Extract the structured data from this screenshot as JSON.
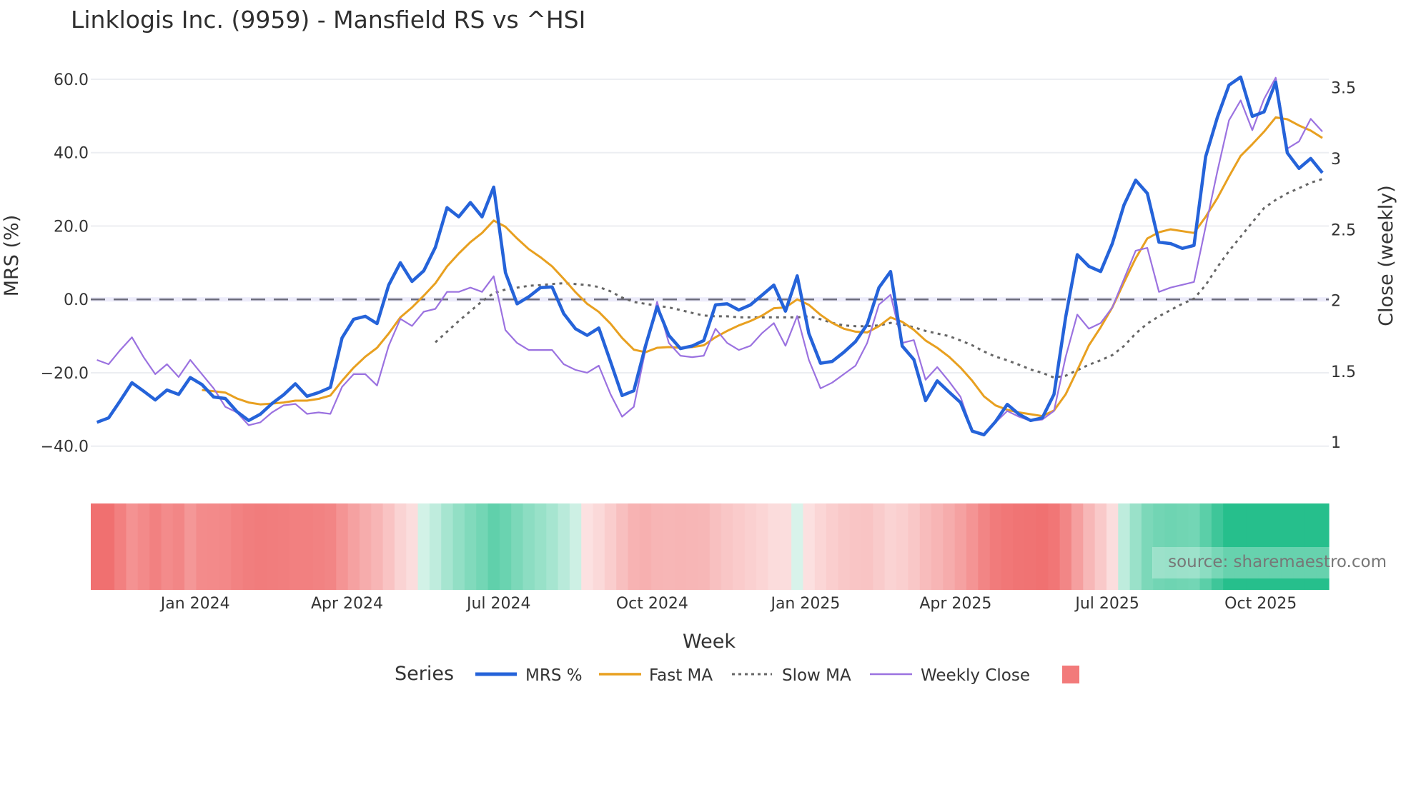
{
  "chart_data": {
    "type": "line",
    "title": "Linklogis Inc. (9959) - Mansfield RS vs ^HSI",
    "xlabel": "Week",
    "ylabel": "MRS (%)",
    "y2label": "Close (weekly)",
    "start_week": "2023-11-03",
    "x_ticks": [
      {
        "label": "Jan 2024",
        "date": "2024-01-01"
      },
      {
        "label": "Apr 2024",
        "date": "2024-04-01"
      },
      {
        "label": "Jul 2024",
        "date": "2024-07-01"
      },
      {
        "label": "Oct 2024",
        "date": "2024-10-01"
      },
      {
        "label": "Jan 2025",
        "date": "2025-01-01"
      },
      {
        "label": "Apr 2025",
        "date": "2025-04-01"
      },
      {
        "label": "Jul 2025",
        "date": "2025-07-01"
      },
      {
        "label": "Oct 2025",
        "date": "2025-10-01"
      }
    ],
    "y_ticks": [
      "60.0",
      "40.0",
      "20.0",
      "0.0",
      "−20.0",
      "−40.0"
    ],
    "y_tick_values": [
      60,
      40,
      20,
      0,
      -20,
      -40
    ],
    "y2_ticks": [
      "3.5",
      "3",
      "2.5",
      "2",
      "1.5",
      "1"
    ],
    "y2_tick_values": [
      3.5,
      3,
      2.5,
      2,
      1.5,
      1
    ],
    "ylim": [
      -45.5,
      67
    ],
    "y2lim": [
      0.83,
      3.74
    ],
    "grid": true,
    "zero_line": 0,
    "series": [
      {
        "name": "MRS %",
        "color": "#2563d9",
        "axis": "left",
        "values": [
          -33.5,
          -32.3,
          -27.6,
          -22.7,
          -25,
          -27.4,
          -24.7,
          -25.9,
          -21.3,
          -23.2,
          -26.6,
          -27,
          -30.6,
          -33,
          -31.3,
          -28.4,
          -26,
          -23,
          -26.4,
          -25.4,
          -24,
          -10.5,
          -5.4,
          -4.6,
          -6.6,
          3.9,
          10,
          4.9,
          7.8,
          14.2,
          25,
          22.5,
          26.4,
          22.5,
          30.6,
          7.3,
          -1.2,
          0.7,
          3.2,
          3.4,
          -3.9,
          -8,
          -9.8,
          -7.8,
          -16.9,
          -26.2,
          -24.9,
          -12.7,
          -2,
          -9.8,
          -13.4,
          -12.7,
          -11.2,
          -1.5,
          -1.2,
          -2.9,
          -1.5,
          1.2,
          3.9,
          -3.2,
          6.4,
          -9.3,
          -17.4,
          -16.9,
          -14.4,
          -11.5,
          -6.8,
          3.2,
          7.6,
          -12.7,
          -16.4,
          -27.6,
          -22.2,
          -25.2,
          -28.1,
          -35.9,
          -36.9,
          -33.3,
          -28.6,
          -31.3,
          -33,
          -32.3,
          -25.9,
          -4.9,
          12.2,
          9,
          7.6,
          15.2,
          25.7,
          32.5,
          28.9,
          15.6,
          15.2,
          13.9,
          14.7,
          38.9,
          49.6,
          58.4,
          60.6,
          49.9,
          51.1,
          59.2,
          39.9,
          35.7,
          38.4,
          34.5
        ]
      },
      {
        "name": "Fast MA",
        "color": "#e8a020",
        "axis": "left",
        "values": [
          -24.7,
          -25,
          -25.4,
          -27,
          -28.1,
          -28.6,
          -28.4,
          -28.1,
          -27.6,
          -27.6,
          -27.1,
          -26.2,
          -22.2,
          -18.6,
          -15.6,
          -13.2,
          -9.3,
          -4.9,
          -2.2,
          1,
          4.4,
          9,
          12.5,
          15.6,
          18.1,
          21.5,
          19.8,
          16.6,
          13.7,
          11.5,
          9,
          5.6,
          2,
          -1.2,
          -3.4,
          -6.6,
          -10.5,
          -13.7,
          -14.4,
          -13.2,
          -13,
          -13.2,
          -13,
          -12.5,
          -10.3,
          -8.6,
          -7.1,
          -5.9,
          -4.4,
          -2.4,
          -2.2,
          0,
          -1.5,
          -4.2,
          -6.4,
          -8,
          -8.8,
          -9,
          -7.3,
          -4.9,
          -6.1,
          -8.3,
          -11.2,
          -13.2,
          -15.6,
          -18.6,
          -22.2,
          -26.4,
          -28.9,
          -30.1,
          -30.8,
          -31.3,
          -31.8,
          -30.3,
          -25.9,
          -19.3,
          -12.5,
          -7.6,
          -2.2,
          4.6,
          11.2,
          16.6,
          18.3,
          19.1,
          18.6,
          18.1,
          22.5,
          27.6,
          33.5,
          39.1,
          42.3,
          45.7,
          49.6,
          49.1,
          47.4,
          46,
          44
        ]
      },
      {
        "name": "Slow MA",
        "color": "#666666",
        "axis": "left",
        "dash": "dot",
        "values": [
          -11.7,
          -8.8,
          -5.9,
          -3.2,
          -0.5,
          1.7,
          2.7,
          3.2,
          3.7,
          3.9,
          4.2,
          4.4,
          4.2,
          3.9,
          3.4,
          2.2,
          0.5,
          -0.7,
          -1.2,
          -1.7,
          -2.2,
          -2.9,
          -3.7,
          -4.4,
          -4.6,
          -4.6,
          -4.9,
          -4.9,
          -4.9,
          -4.9,
          -4.9,
          -4.9,
          -4.6,
          -5.4,
          -6.4,
          -7.1,
          -7.3,
          -7.3,
          -7.1,
          -6.4,
          -6.8,
          -7.6,
          -8.6,
          -9.3,
          -10,
          -11.2,
          -12.5,
          -14.2,
          -15.6,
          -16.6,
          -17.8,
          -19.1,
          -20,
          -21.3,
          -20.8,
          -19.3,
          -17.8,
          -16.6,
          -15.2,
          -12.7,
          -9.3,
          -6.6,
          -4.6,
          -2.9,
          -1.2,
          0.2,
          3.9,
          8.8,
          13.2,
          17.1,
          21,
          24.9,
          27.1,
          28.9,
          30.3,
          31.8,
          32.8
        ]
      },
      {
        "name": "Weekly Close",
        "color": "#9b72e0",
        "axis": "right",
        "values": [
          1.58,
          1.55,
          1.65,
          1.74,
          1.6,
          1.48,
          1.55,
          1.46,
          1.58,
          1.48,
          1.38,
          1.25,
          1.21,
          1.12,
          1.14,
          1.21,
          1.26,
          1.27,
          1.2,
          1.21,
          1.2,
          1.39,
          1.48,
          1.48,
          1.4,
          1.68,
          1.87,
          1.82,
          1.92,
          1.94,
          2.06,
          2.06,
          2.09,
          2.06,
          2.17,
          1.79,
          1.7,
          1.65,
          1.65,
          1.65,
          1.55,
          1.51,
          1.49,
          1.54,
          1.34,
          1.18,
          1.25,
          1.65,
          1.99,
          1.7,
          1.61,
          1.6,
          1.61,
          1.8,
          1.7,
          1.65,
          1.68,
          1.77,
          1.84,
          1.68,
          1.89,
          1.58,
          1.38,
          1.42,
          1.48,
          1.54,
          1.7,
          1.97,
          2.04,
          1.7,
          1.72,
          1.44,
          1.53,
          1.43,
          1.32,
          1.08,
          1.06,
          1.14,
          1.22,
          1.18,
          1.15,
          1.16,
          1.22,
          1.6,
          1.9,
          1.8,
          1.84,
          1.95,
          2.15,
          2.35,
          2.37,
          2.06,
          2.09,
          2.11,
          2.13,
          2.52,
          2.91,
          3.27,
          3.41,
          3.2,
          3.42,
          3.57,
          3.07,
          3.12,
          3.28,
          3.19
        ]
      }
    ],
    "heatmap": {
      "name": "regime strip",
      "negative_color": "#f07070",
      "positive_color": "#26bf8c",
      "driven_by": "Fast MA"
    },
    "legend": {
      "title": "Series",
      "placement": "bottom-center",
      "items": [
        "MRS %",
        "Fast MA",
        "Slow MA",
        "Weekly Close"
      ],
      "swatch_color": "#f27a7a"
    },
    "source": "source: sharemaestro.com"
  }
}
